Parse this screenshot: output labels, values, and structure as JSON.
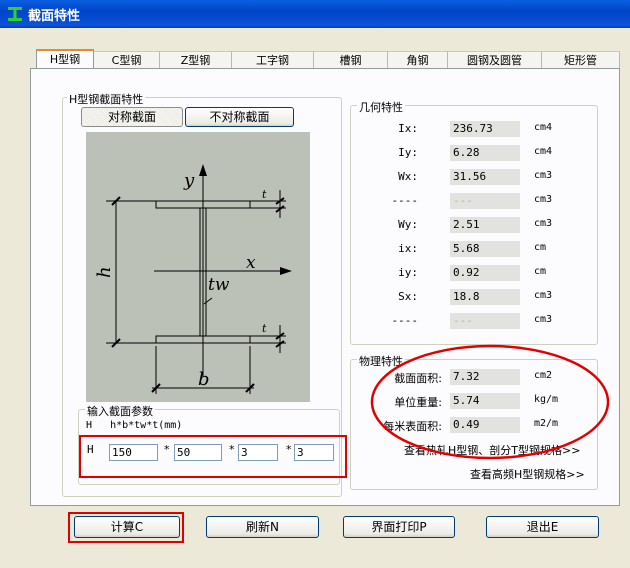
{
  "window": {
    "title": "截面特性"
  },
  "tabs": [
    "H型钢",
    "C型钢",
    "Z型钢",
    "工字钢",
    "槽钢",
    "角钢",
    "圆钢及圆管",
    "矩形管"
  ],
  "section_group": {
    "title": "H型钢截面特性",
    "sym_button": "对称截面",
    "asym_button": "不对称截面"
  },
  "diagram": {
    "y": "y",
    "x": "x",
    "tw": "tw",
    "h": "h",
    "b": "b",
    "t": "t"
  },
  "input_group": {
    "title": "输入截面参数",
    "formula": "H   h*b*tw*t(mm)",
    "prefix": "H",
    "h": "150",
    "b": "50",
    "tw": "3",
    "t": "3",
    "sep": "*"
  },
  "geometry": {
    "title": "几何特性",
    "rows": [
      {
        "label": "Ix:",
        "value": "236.73",
        "unit": "cm4"
      },
      {
        "label": "Iy:",
        "value": "6.28",
        "unit": "cm4"
      },
      {
        "label": "Wx:",
        "value": "31.56",
        "unit": "cm3"
      },
      {
        "label": "----",
        "value": "---",
        "unit": "cm3"
      },
      {
        "label": "Wy:",
        "value": "2.51",
        "unit": "cm3"
      },
      {
        "label": "ix:",
        "value": "5.68",
        "unit": "cm"
      },
      {
        "label": "iy:",
        "value": "0.92",
        "unit": "cm"
      },
      {
        "label": "Sx:",
        "value": "18.8",
        "unit": "cm3"
      },
      {
        "label": "----",
        "value": "---",
        "unit": "cm3"
      }
    ]
  },
  "physical": {
    "title": "物理特性",
    "rows": [
      {
        "label": "截面面积:",
        "value": "7.32",
        "unit": "cm2"
      },
      {
        "label": "单位重量:",
        "value": "5.74",
        "unit": "kg/m"
      },
      {
        "label": "每米表面积:",
        "value": "0.49",
        "unit": "m2/m"
      }
    ],
    "link1": "查看热轧H型钢、剖分T型钢规格>>",
    "link2": "查看高频H型钢规格>>"
  },
  "buttons": {
    "calc": "计算C",
    "refresh": "刷新N",
    "print": "界面打印P",
    "exit": "退出E"
  }
}
